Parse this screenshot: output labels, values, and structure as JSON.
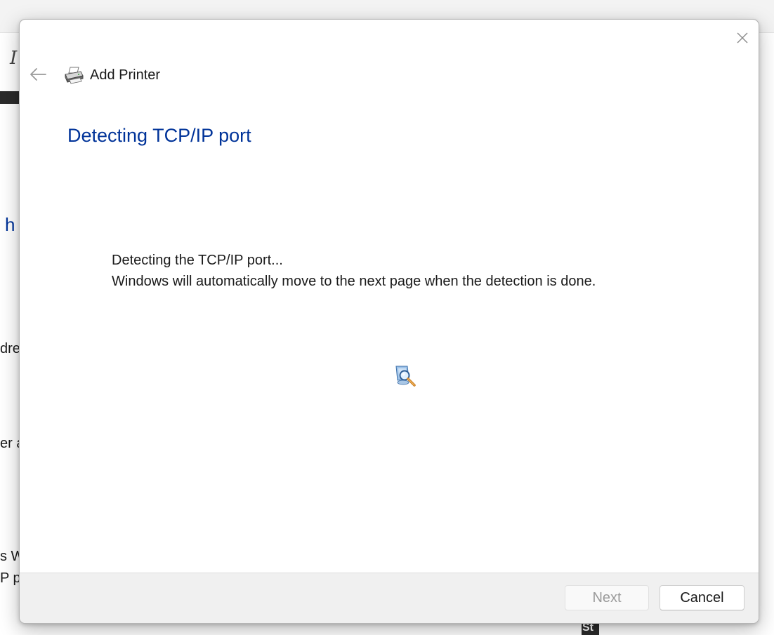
{
  "background": {
    "fragments": [
      {
        "id": "frag1",
        "text": "h"
      },
      {
        "id": "frag2",
        "text": "dre"
      },
      {
        "id": "frag3",
        "text": "er a"
      },
      {
        "id": "frag4",
        "text": "s W"
      },
      {
        "id": "frag5",
        "text": "P p"
      }
    ],
    "dark_box_text": "St"
  },
  "dialog": {
    "title": "Add Printer",
    "heading": "Detecting TCP/IP port",
    "message_line1": "Detecting the TCP/IP port...",
    "message_line2": "Windows will automatically move to the next page when the detection is done.",
    "buttons": {
      "next_label": "Next",
      "next_enabled": false,
      "cancel_label": "Cancel"
    },
    "icons": {
      "close": "close-icon",
      "back": "back-arrow-icon",
      "printer": "printer-icon",
      "search": "search-animation-icon"
    },
    "colors": {
      "heading": "#003399",
      "footer": "#f0f0f0"
    }
  }
}
